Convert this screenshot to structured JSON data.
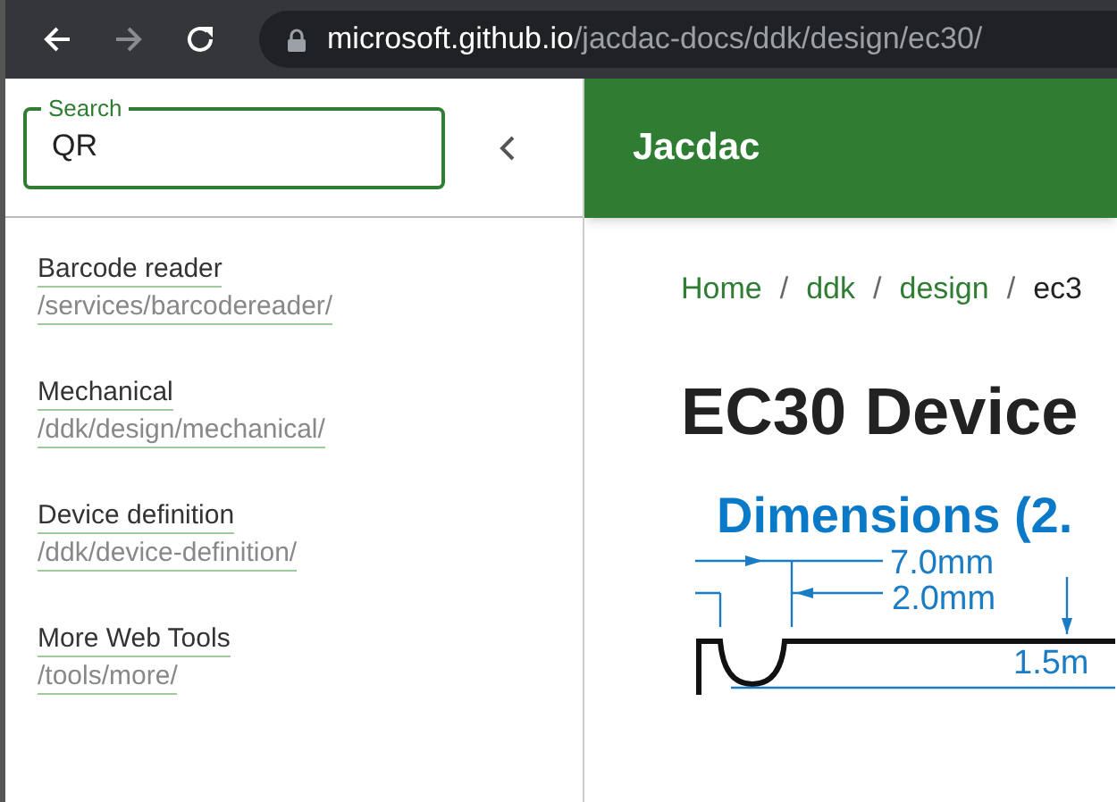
{
  "browser": {
    "url_host": "microsoft.github.io",
    "url_path": "/jacdac-docs/ddk/design/ec30/"
  },
  "sidebar": {
    "search": {
      "label": "Search",
      "value": "QR"
    },
    "results": [
      {
        "title": "Barcode reader",
        "path": "/services/barcodereader/"
      },
      {
        "title": "Mechanical",
        "path": "/ddk/design/mechanical/"
      },
      {
        "title": "Device definition",
        "path": "/ddk/device-definition/"
      },
      {
        "title": "More Web Tools",
        "path": "/tools/more/"
      }
    ]
  },
  "header": {
    "title": "Jacdac"
  },
  "breadcrumb": [
    {
      "label": "Home",
      "link": true
    },
    {
      "separator": "/",
      "label": "ddk",
      "link": true
    },
    {
      "separator": "/",
      "label": "design",
      "link": true
    },
    {
      "separator": "/",
      "label": "ec3",
      "link": false
    }
  ],
  "page": {
    "title": "EC30 Device"
  },
  "figure": {
    "title": "Dimensions (2.",
    "labels": [
      "7.0mm",
      "2.0mm",
      "1.5m"
    ]
  }
}
